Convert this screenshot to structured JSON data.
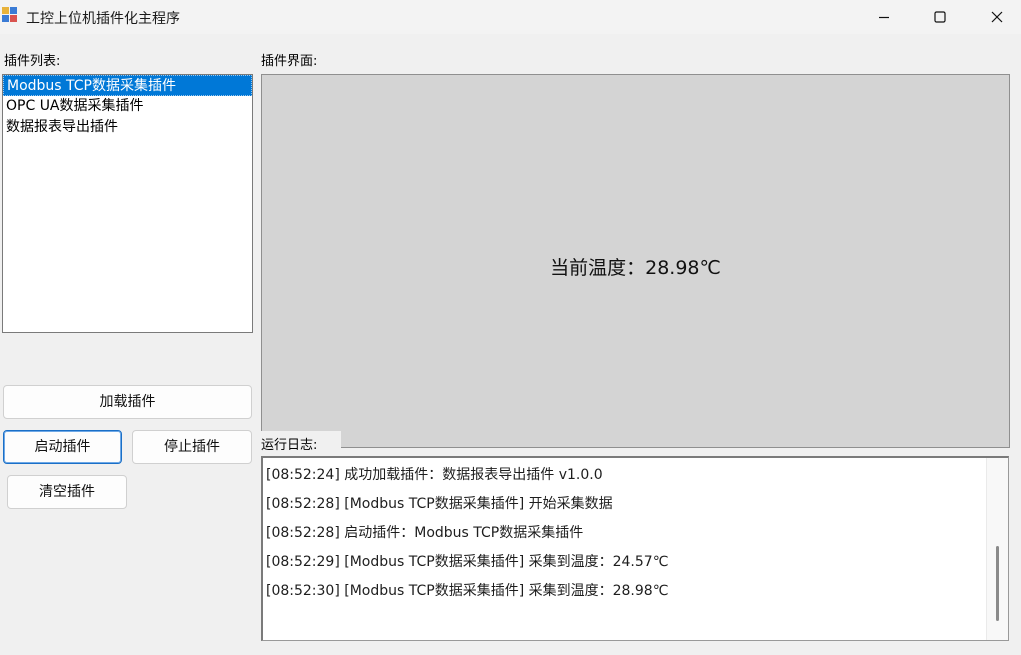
{
  "window": {
    "title": "工控上位机插件化主程序",
    "icon": "app-window-icon",
    "controls": [
      "minimize-icon",
      "maximize-icon",
      "close-icon"
    ]
  },
  "plugin_list": {
    "label": "插件列表:",
    "items": [
      {
        "label": "Modbus TCP数据采集插件",
        "selected": true
      },
      {
        "label": "OPC UA数据采集插件",
        "selected": false
      },
      {
        "label": "数据报表导出插件",
        "selected": false
      }
    ]
  },
  "plugin_panel": {
    "label": "插件界面:",
    "temperature_text": "当前温度：28.98℃"
  },
  "buttons": {
    "load": "加载插件",
    "start": "启动插件",
    "stop": "停止插件",
    "clear": "清空插件"
  },
  "log": {
    "label": "运行日志:",
    "lines": [
      "[08:52:24] 成功加载插件：数据报表导出插件 v1.0.0",
      "[08:52:28] [Modbus TCP数据采集插件] 开始采集数据",
      "[08:52:28] 启动插件：Modbus TCP数据采集插件",
      "[08:52:29] [Modbus TCP数据采集插件] 采集到温度：24.57℃",
      "[08:52:30] [Modbus TCP数据采集插件] 采集到温度：28.98℃"
    ]
  },
  "colors": {
    "selection": "#0078d7",
    "panel_bg": "#d4d4d4",
    "window_bg": "#f0f0f0"
  }
}
